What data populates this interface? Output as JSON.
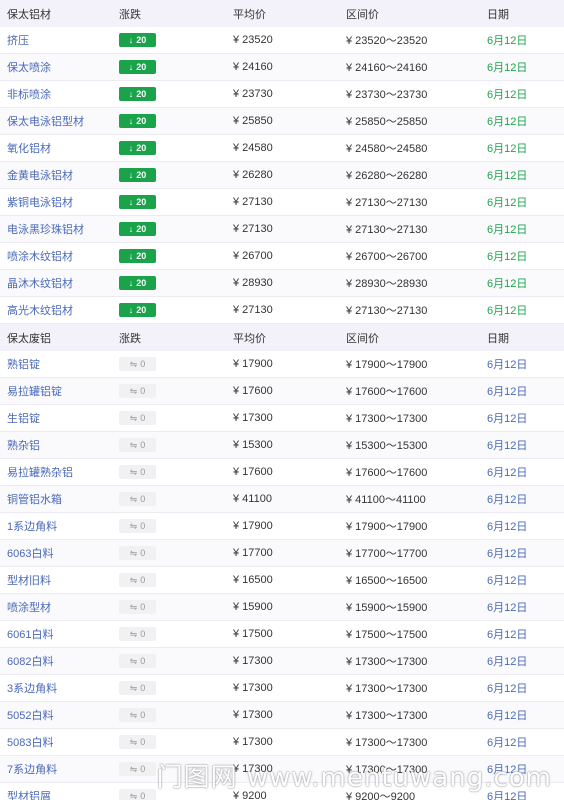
{
  "sections": [
    {
      "header": {
        "name": "保太铝材",
        "change": "涨跌",
        "avg": "平均价",
        "range": "区间价",
        "date": "日期"
      },
      "rows": [
        {
          "name": "挤压",
          "change": "20",
          "avg": "¥ 23520",
          "range": "¥ 23520～23520",
          "date": "6月12日"
        },
        {
          "name": "保太喷涂",
          "change": "20",
          "avg": "¥ 24160",
          "range": "¥ 24160～24160",
          "date": "6月12日"
        },
        {
          "name": "非标喷涂",
          "change": "20",
          "avg": "¥ 23730",
          "range": "¥ 23730～23730",
          "date": "6月12日"
        },
        {
          "name": "保太电泳铝型材",
          "change": "20",
          "avg": "¥ 25850",
          "range": "¥ 25850～25850",
          "date": "6月12日"
        },
        {
          "name": "氧化铝材",
          "change": "20",
          "avg": "¥ 24580",
          "range": "¥ 24580～24580",
          "date": "6月12日"
        },
        {
          "name": "金黄电泳铝材",
          "change": "20",
          "avg": "¥ 26280",
          "range": "¥ 26280～26280",
          "date": "6月12日"
        },
        {
          "name": "紫铜电泳铝材",
          "change": "20",
          "avg": "¥ 27130",
          "range": "¥ 27130～27130",
          "date": "6月12日"
        },
        {
          "name": "电泳黑珍珠铝材",
          "change": "20",
          "avg": "¥ 27130",
          "range": "¥ 27130～27130",
          "date": "6月12日"
        },
        {
          "name": "喷涂木纹铝材",
          "change": "20",
          "avg": "¥ 26700",
          "range": "¥ 26700～26700",
          "date": "6月12日"
        },
        {
          "name": "晶沐木纹铝材",
          "change": "20",
          "avg": "¥ 28930",
          "range": "¥ 28930～28930",
          "date": "6月12日"
        },
        {
          "name": "高光木纹铝材",
          "change": "20",
          "avg": "¥ 27130",
          "range": "¥ 27130～27130",
          "date": "6月12日"
        }
      ]
    },
    {
      "header": {
        "name": "保太废铝",
        "change": "涨跌",
        "avg": "平均价",
        "range": "区间价",
        "date": "日期"
      },
      "rows": [
        {
          "name": "熟铝锭",
          "change": "0",
          "avg": "¥ 17900",
          "range": "¥ 17900～17900",
          "date": "6月12日"
        },
        {
          "name": "易拉罐铝锭",
          "change": "0",
          "avg": "¥ 17600",
          "range": "¥ 17600～17600",
          "date": "6月12日"
        },
        {
          "name": "生铝锭",
          "change": "0",
          "avg": "¥ 17300",
          "range": "¥ 17300～17300",
          "date": "6月12日"
        },
        {
          "name": "熟杂铝",
          "change": "0",
          "avg": "¥ 15300",
          "range": "¥ 15300～15300",
          "date": "6月12日"
        },
        {
          "name": "易拉罐熟杂铝",
          "change": "0",
          "avg": "¥ 17600",
          "range": "¥ 17600～17600",
          "date": "6月12日"
        },
        {
          "name": "铜管铝水箱",
          "change": "0",
          "avg": "¥ 41100",
          "range": "¥ 41100～41100",
          "date": "6月12日"
        },
        {
          "name": "1系边角料",
          "change": "0",
          "avg": "¥ 17900",
          "range": "¥ 17900～17900",
          "date": "6月12日"
        },
        {
          "name": "6063白料",
          "change": "0",
          "avg": "¥ 17700",
          "range": "¥ 17700～17700",
          "date": "6月12日"
        },
        {
          "name": "型材旧料",
          "change": "0",
          "avg": "¥ 16500",
          "range": "¥ 16500～16500",
          "date": "6月12日"
        },
        {
          "name": "喷涂型材",
          "change": "0",
          "avg": "¥ 15900",
          "range": "¥ 15900～15900",
          "date": "6月12日"
        },
        {
          "name": "6061白料",
          "change": "0",
          "avg": "¥ 17500",
          "range": "¥ 17500～17500",
          "date": "6月12日"
        },
        {
          "name": "6082白料",
          "change": "0",
          "avg": "¥ 17300",
          "range": "¥ 17300～17300",
          "date": "6月12日"
        },
        {
          "name": "3系边角料",
          "change": "0",
          "avg": "¥ 17300",
          "range": "¥ 17300～17300",
          "date": "6月12日"
        },
        {
          "name": "5052白料",
          "change": "0",
          "avg": "¥ 17300",
          "range": "¥ 17300～17300",
          "date": "6月12日"
        },
        {
          "name": "5083白料",
          "change": "0",
          "avg": "¥ 17300",
          "range": "¥ 17300～17300",
          "date": "6月12日"
        },
        {
          "name": "7系边角料",
          "change": "0",
          "avg": "¥ 17300",
          "range": "¥ 17300～17300",
          "date": "6月12日"
        },
        {
          "name": "型材铝屑",
          "change": "0",
          "avg": "¥ 9200",
          "range": "¥ 9200～9200",
          "date": "6月12日"
        }
      ]
    }
  ],
  "icons": {
    "down": "arrow-down-icon",
    "flat": "flat-arrows-icon"
  },
  "colors": {
    "down_badge": "#1aa34a",
    "flat_badge": "#f1f1f4",
    "name_link": "#4a69b8",
    "date_green": "#1ea44c",
    "date_blue": "#4a69b8",
    "header_bg": "#f3f2fa"
  },
  "watermark": "门图网 www.mentuwang.com"
}
